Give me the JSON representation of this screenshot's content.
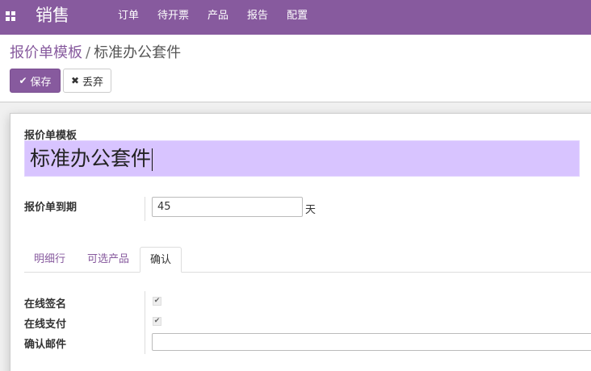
{
  "topbar": {
    "app_name": "销售",
    "menu": [
      "订单",
      "待开票",
      "产品",
      "报告",
      "配置"
    ]
  },
  "breadcrumb": {
    "parent": "报价单模板",
    "separator": "/",
    "current": "标准办公套件"
  },
  "buttons": {
    "save": "保存",
    "discard": "丢弃"
  },
  "form": {
    "name_label": "报价单模板",
    "name_value": "标准办公套件",
    "validity_label": "报价单到期",
    "validity_value": "45",
    "validity_unit": "天",
    "tabs": [
      "明细行",
      "可选产品",
      "确认"
    ],
    "active_tab": "确认",
    "confirmation": {
      "online_signature_label": "在线签名",
      "online_signature_checked": true,
      "online_payment_label": "在线支付",
      "online_payment_checked": true,
      "confirmation_mail_label": "确认邮件",
      "confirmation_mail_value": ""
    }
  },
  "colors": {
    "brand": "#875a9e",
    "name_field_bg": "#d8c4ff"
  },
  "icons": {
    "apps": "apps-grid-icon",
    "save": "check-icon",
    "discard": "close-icon",
    "checkbox": "checkmark-icon"
  }
}
